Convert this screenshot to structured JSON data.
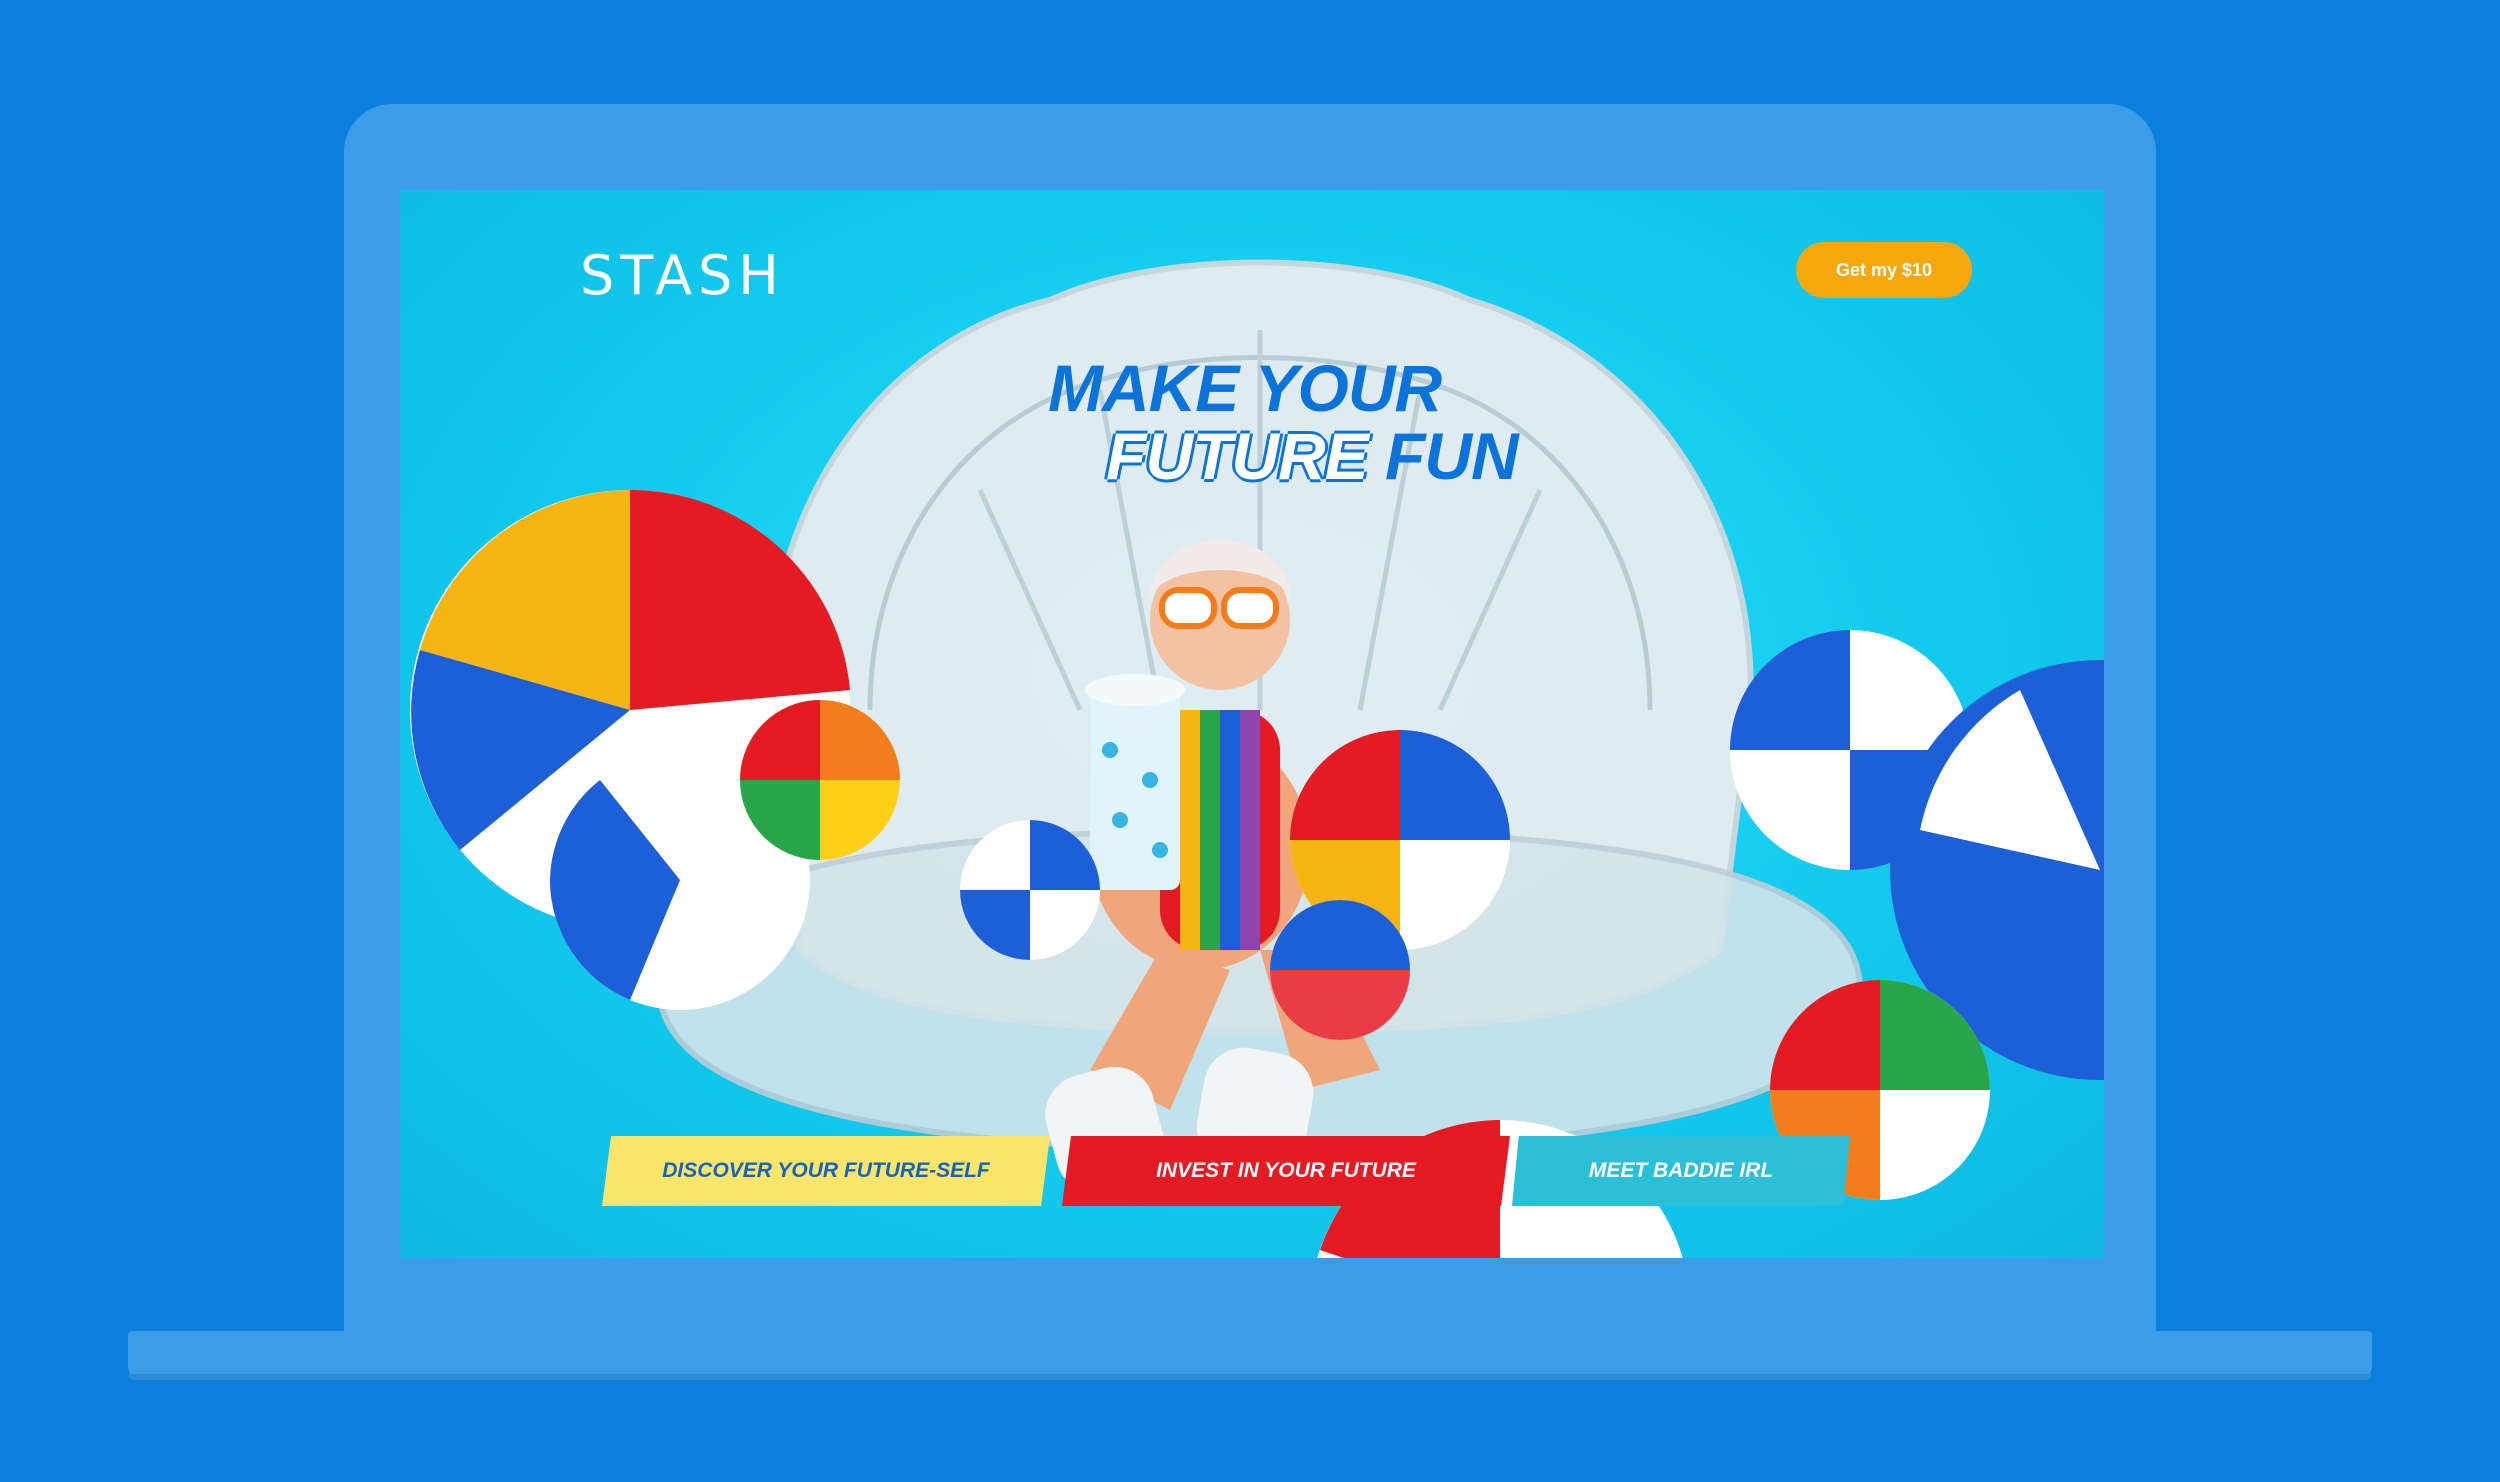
{
  "brand": {
    "logo_text": "STASH"
  },
  "header": {
    "cta_label": "Get my $10"
  },
  "hero": {
    "headline_line1": "MAKE YOUR",
    "headline_line2_outlined": "FUTURE",
    "headline_line2_rest": " FUN"
  },
  "nav": {
    "tabs": [
      {
        "label": "DISCOVER YOUR FUTURE-SELF"
      },
      {
        "label": "INVEST IN YOUR FUTURE"
      },
      {
        "label": "MEET BADDIE IRL"
      }
    ]
  },
  "colors": {
    "page_background": "#0a7fdc",
    "laptop_frame": "#3b9cea",
    "screen_background": "#12cbee",
    "cta_orange": "#f5a80c",
    "headline_blue": "#0b73d9",
    "tab_yellow": "#fbe56a",
    "tab_red": "#e51b24",
    "tab_teal": "#2bbfd8"
  }
}
